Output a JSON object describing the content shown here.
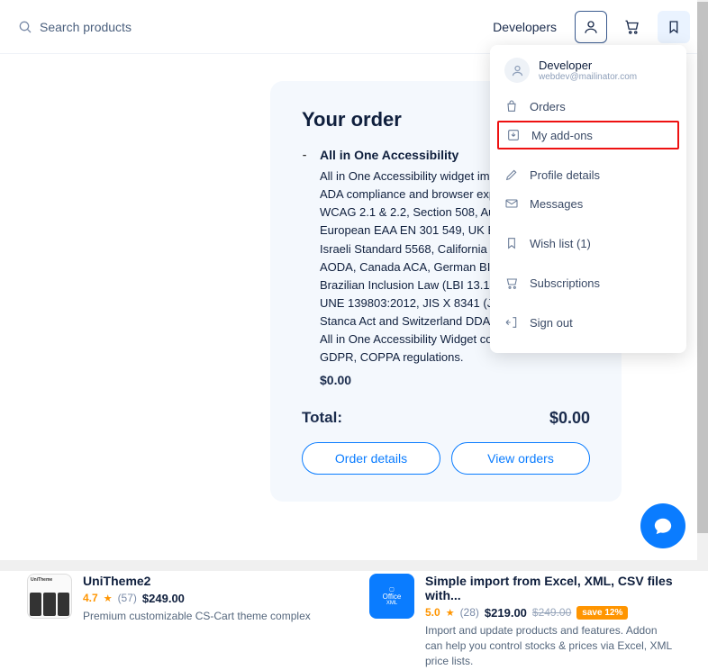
{
  "header": {
    "search_placeholder": "Search products",
    "developers_link": "Developers"
  },
  "dropdown": {
    "user_name": "Developer",
    "user_email": "webdev@mailinator.com",
    "items": [
      {
        "label": "Orders",
        "icon": "bag-icon"
      },
      {
        "label": "My add-ons",
        "icon": "download-box-icon",
        "highlighted": true
      },
      {
        "label": "Profile details",
        "icon": "pencil-icon"
      },
      {
        "label": "Messages",
        "icon": "mail-icon"
      },
      {
        "label": "Wish list (1)",
        "icon": "bookmark-icon"
      },
      {
        "label": "Subscriptions",
        "icon": "cart-icon"
      },
      {
        "label": "Sign out",
        "icon": "signout-icon"
      }
    ]
  },
  "order": {
    "title": "Your order",
    "item_name": "All in One Accessibility",
    "item_desc": "All in One Accessibility widget improves website ADA compliance and browser experience for ADA, WCAG 2.1 & 2.2, Section 508, Australian DDA, European EAA EN 301 549, UK Equality Act (EA), Israeli Standard 5568, California Unruh, Ontario AODA, Canada ACA, German BITV, France RGAA, Brazilian Inclusion Law (LBI 13.146/2015), Spain UNE 139803:2012, JIS X 8341 (Japan), Italian Stanca Act and Switzerland DDA Standards. Your All in One Accessibility Widget complies with GDPR, COPPA regulations.",
    "item_price": "$0.00",
    "total_label": "Total:",
    "total_value": "$0.00",
    "btn_details": "Order details",
    "btn_view": "View orders"
  },
  "products": [
    {
      "name": "UniTheme2",
      "rating": "4.7",
      "reviews": "(57)",
      "price": "$249.00",
      "desc": "Premium customizable CS-Cart theme complex",
      "thumb_label": "UniTheme"
    },
    {
      "name": "Simple import from Excel, XML, CSV files with...",
      "rating": "5.0",
      "reviews": "(28)",
      "price": "$219.00",
      "old_price": "$249.00",
      "save_badge": "save 12%",
      "desc": "Import and update products and features. Addon can help you control stocks & prices via Excel, XML price lists.",
      "thumb_label_top": "Office",
      "thumb_label_bottom": "XML"
    }
  ]
}
